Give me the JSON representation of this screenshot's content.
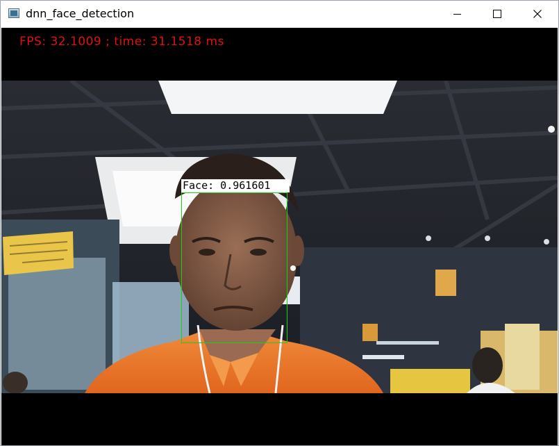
{
  "window": {
    "title": "dnn_face_detection"
  },
  "titlebar": {
    "minimize": "minimize",
    "maximize": "maximize",
    "close": "close"
  },
  "overlay": {
    "fps_text": "FPS: 32.1009 ; time: 31.1518 ms"
  },
  "detection": {
    "label": "Face: 0.961601"
  },
  "colors": {
    "fps_text": "#e01010",
    "bbox": "#18d018",
    "label_bg": "#ffffff"
  },
  "icons": {
    "app": "app-window-icon",
    "minimize": "minimize-icon",
    "maximize": "maximize-icon",
    "close": "close-icon"
  }
}
